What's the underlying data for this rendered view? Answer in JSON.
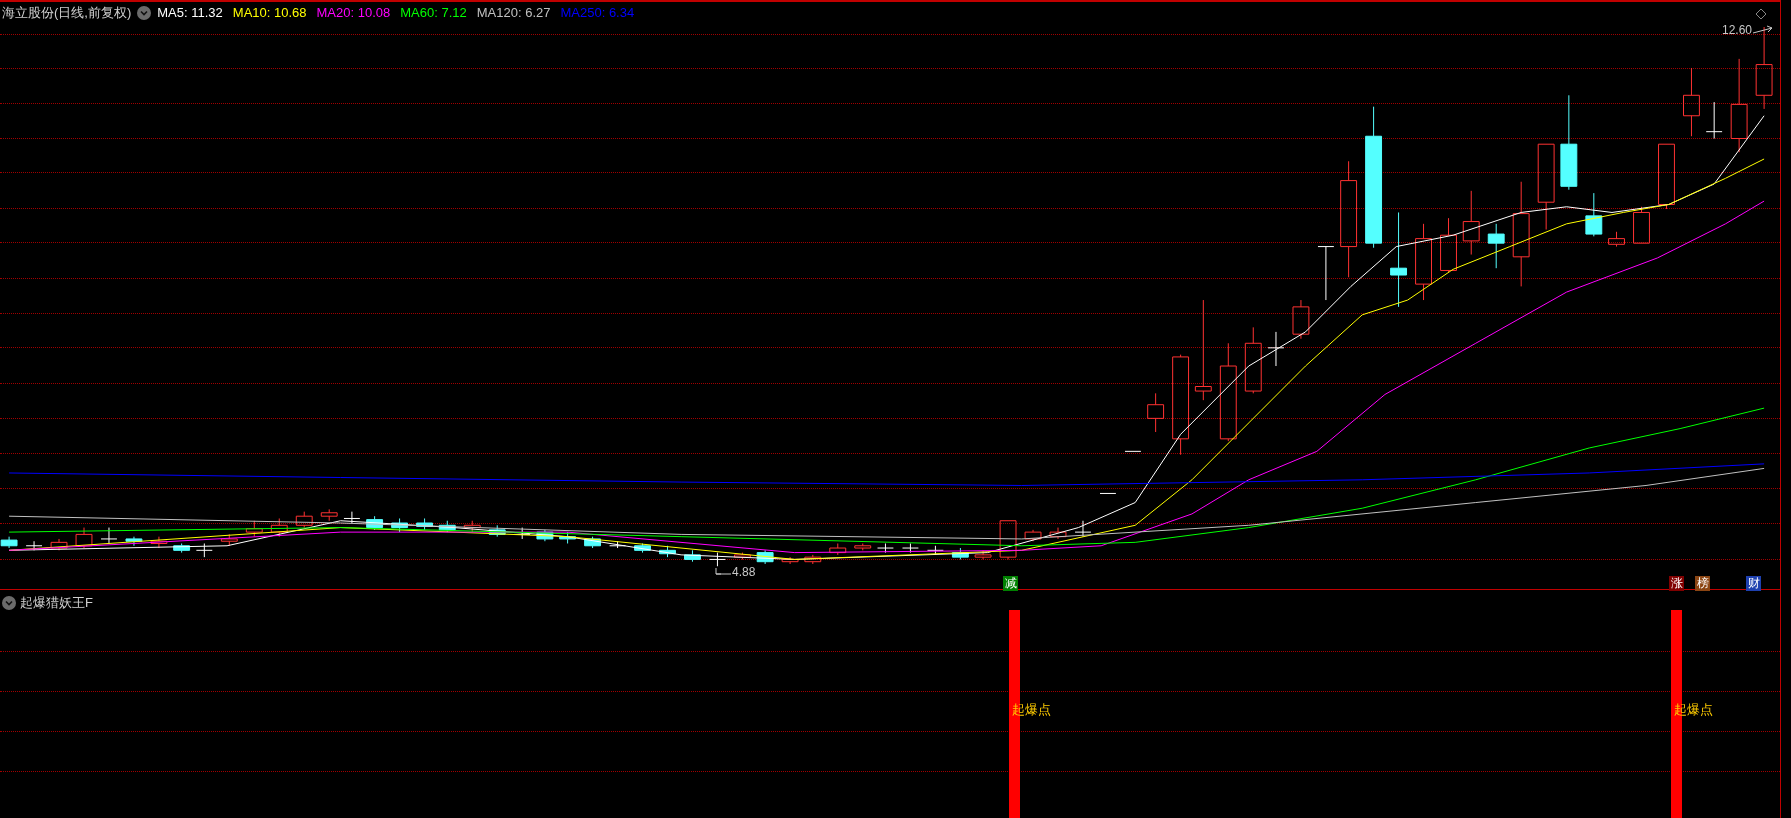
{
  "header": {
    "title": "海立股份(日线,前复权)",
    "moving_averages": [
      {
        "label": "MA5: 11.32",
        "color": "#ffffff"
      },
      {
        "label": "MA10: 10.68",
        "color": "#ffff00"
      },
      {
        "label": "MA20: 10.08",
        "color": "#ff00ff"
      },
      {
        "label": "MA60: 7.12",
        "color": "#00ff00"
      },
      {
        "label": "MA120: 6.27",
        "color": "#c0c0c0"
      },
      {
        "label": "MA250: 6.34",
        "color": "#0000ff"
      }
    ]
  },
  "price_labels": {
    "high": "12.60",
    "low": "4.88"
  },
  "markers": [
    {
      "text": "减",
      "color": "#008000"
    },
    {
      "text": "涨",
      "color": "#800000"
    },
    {
      "text": "榜",
      "color": "#8b4513"
    },
    {
      "text": "财",
      "color": "#1e40af"
    }
  ],
  "indicator": {
    "title": "起爆猎妖王F",
    "signals": [
      {
        "label": "起爆点"
      },
      {
        "label": "起爆点"
      }
    ]
  }
}
